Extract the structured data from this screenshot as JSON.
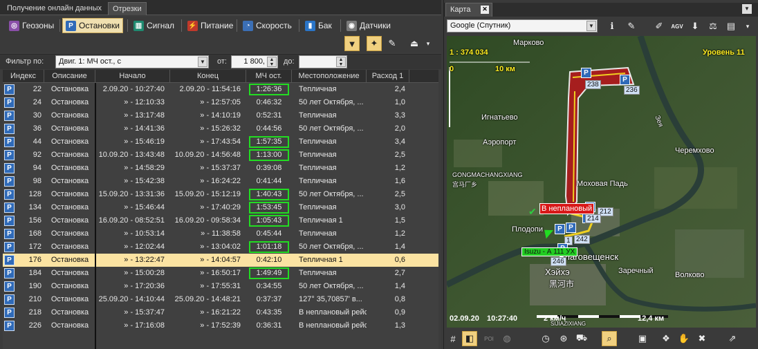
{
  "tabs": {
    "online": "Получение онлайн данных",
    "segments": "Отрезки"
  },
  "filters": [
    {
      "label": "Геозоны",
      "icon": "geozone-icon",
      "color": "#8a4fa8"
    },
    {
      "label": "Остановки",
      "icon": "parking-icon",
      "color": "#2f6ab8",
      "active": true
    },
    {
      "label": "Сигнал",
      "icon": "signal-icon",
      "color": "#1f8a70"
    },
    {
      "label": "Питание",
      "icon": "power-icon",
      "color": "#c0392b"
    },
    {
      "label": "Скорость",
      "icon": "speed-icon",
      "color": "#3b6fb5"
    },
    {
      "label": "Бак",
      "icon": "tank-icon",
      "color": "#2a75c8"
    },
    {
      "label": "Датчики",
      "icon": "sensor-icon",
      "color": "#7a7a7a"
    }
  ],
  "filterrow": {
    "label": "Фильтр по:",
    "combo": "Двиг. 1: МЧ ост., с",
    "from_label": "от:",
    "from_value": "1 800,",
    "to_label": "до:",
    "to_value": ""
  },
  "columns": [
    "Индекс",
    "Описание",
    "Начало",
    "Конец",
    "МЧ ост.",
    "Местоположение",
    "Расход 1"
  ],
  "rows": [
    {
      "idx": "22",
      "desc": "Остановка",
      "start": "2.09.20 - 10:27:40",
      "end": "2.09.20 - 11:54:16",
      "mh": "1:26:36",
      "loc": "Тепличная",
      "fuel": "2,4",
      "hl": true
    },
    {
      "idx": "24",
      "desc": "Остановка",
      "start": "» - 12:10:33",
      "end": "» - 12:57:05",
      "mh": "0:46:32",
      "loc": "50 лет Октября, ...",
      "fuel": "1,0"
    },
    {
      "idx": "30",
      "desc": "Остановка",
      "start": "» - 13:17:48",
      "end": "» - 14:10:19",
      "mh": "0:52:31",
      "loc": "Тепличная",
      "fuel": "3,3"
    },
    {
      "idx": "36",
      "desc": "Остановка",
      "start": "» - 14:41:36",
      "end": "» - 15:26:32",
      "mh": "0:44:56",
      "loc": "50 лет Октября, ...",
      "fuel": "2,0"
    },
    {
      "idx": "44",
      "desc": "Остановка",
      "start": "» - 15:46:19",
      "end": "» - 17:43:54",
      "mh": "1:57:35",
      "loc": "Тепличная",
      "fuel": "3,4",
      "hl": true
    },
    {
      "idx": "92",
      "desc": "Остановка",
      "start": "10.09.20 - 13:43:48",
      "end": "10.09.20 - 14:56:48",
      "mh": "1:13:00",
      "loc": "Тепличная",
      "fuel": "2,5",
      "hl": true
    },
    {
      "idx": "94",
      "desc": "Остановка",
      "start": "» - 14:58:29",
      "end": "» - 15:37:37",
      "mh": "0:39:08",
      "loc": "Тепличная",
      "fuel": "1,2"
    },
    {
      "idx": "98",
      "desc": "Остановка",
      "start": "» - 15:42:38",
      "end": "» - 16:24:22",
      "mh": "0:41:44",
      "loc": "Тепличная",
      "fuel": "1,6"
    },
    {
      "idx": "128",
      "desc": "Остановка",
      "start": "15.09.20 - 13:31:36",
      "end": "15.09.20 - 15:12:19",
      "mh": "1:40:43",
      "loc": "50 лет Октября, ...",
      "fuel": "2,5",
      "hl": true
    },
    {
      "idx": "134",
      "desc": "Остановка",
      "start": "» - 15:46:44",
      "end": "» - 17:40:29",
      "mh": "1:53:45",
      "loc": "Тепличная",
      "fuel": "3,0",
      "hl": true
    },
    {
      "idx": "156",
      "desc": "Остановка",
      "start": "16.09.20 - 08:52:51",
      "end": "16.09.20 - 09:58:34",
      "mh": "1:05:43",
      "loc": "Тепличная 1",
      "fuel": "1,5",
      "hl": true
    },
    {
      "idx": "168",
      "desc": "Остановка",
      "start": "» - 10:53:14",
      "end": "» - 11:38:58",
      "mh": "0:45:44",
      "loc": "Тепличная",
      "fuel": "1,2"
    },
    {
      "idx": "172",
      "desc": "Остановка",
      "start": "» - 12:02:44",
      "end": "» - 13:04:02",
      "mh": "1:01:18",
      "loc": "50 лет Октября, ...",
      "fuel": "1,4",
      "hl": true
    },
    {
      "idx": "176",
      "desc": "Остановка",
      "start": "» - 13:22:47",
      "end": "» - 14:04:57",
      "mh": "0:42:10",
      "loc": "Тепличная 1",
      "fuel": "0,6",
      "sel": true
    },
    {
      "idx": "184",
      "desc": "Остановка",
      "start": "» - 15:00:28",
      "end": "» - 16:50:17",
      "mh": "1:49:49",
      "loc": "Тепличная",
      "fuel": "2,7",
      "hl": true
    },
    {
      "idx": "190",
      "desc": "Остановка",
      "start": "» - 17:20:36",
      "end": "» - 17:55:31",
      "mh": "0:34:55",
      "loc": "50 лет Октября, ...",
      "fuel": "1,4"
    },
    {
      "idx": "210",
      "desc": "Остановка",
      "start": "25.09.20 - 14:10:44",
      "end": "25.09.20 - 14:48:21",
      "mh": "0:37:37",
      "loc": "127° 35,70857' в...",
      "fuel": "0,8"
    },
    {
      "idx": "218",
      "desc": "Остановка",
      "start": "» - 15:37:47",
      "end": "» - 16:21:22",
      "mh": "0:43:35",
      "loc": "В неплановый рейс",
      "fuel": "0,9"
    },
    {
      "idx": "226",
      "desc": "Остановка",
      "start": "» - 17:16:08",
      "end": "» - 17:52:39",
      "mh": "0:36:31",
      "loc": "В неплановый рейс",
      "fuel": "1,3"
    }
  ],
  "map": {
    "tab": "Карта",
    "provider": "Google (Спутник)",
    "scale": "1 : 374 034",
    "level": "Уровень 11",
    "ruler_zero": "0",
    "ruler_dist": "10 км",
    "date": "02.09.20",
    "time": "10:27:40",
    "speed": "2 км/ч",
    "distance": "12,4 км",
    "labels": {
      "markovo": "Марково",
      "ignatevo": "Игнатьево",
      "aeroport": "Аэропорт",
      "gongmachang": "GONGMACHANGXIANG",
      "gongmachang_cn": "宫马厂乡",
      "mokhovaya": "Моховая Падь",
      "cheremkhovo": "Черемхово",
      "plodopit": "Плодопи",
      "blagoveshchensk": "Благовещенск",
      "heihe": "Хэйхэ",
      "heihe_cn": "黑河市",
      "zarechny": "Заречный",
      "volkovo": "Волково",
      "river": "Зея",
      "sijia": "SIJIAZIXIANG"
    },
    "pins": {
      "p236": "236",
      "p238": "238",
      "p212": "212",
      "p214": "214",
      "p242": "242",
      "p246": "246",
      "p1a": "1"
    },
    "unplanned": "В неплановый",
    "vehicle": "Isuzu - А 111 УХ"
  }
}
